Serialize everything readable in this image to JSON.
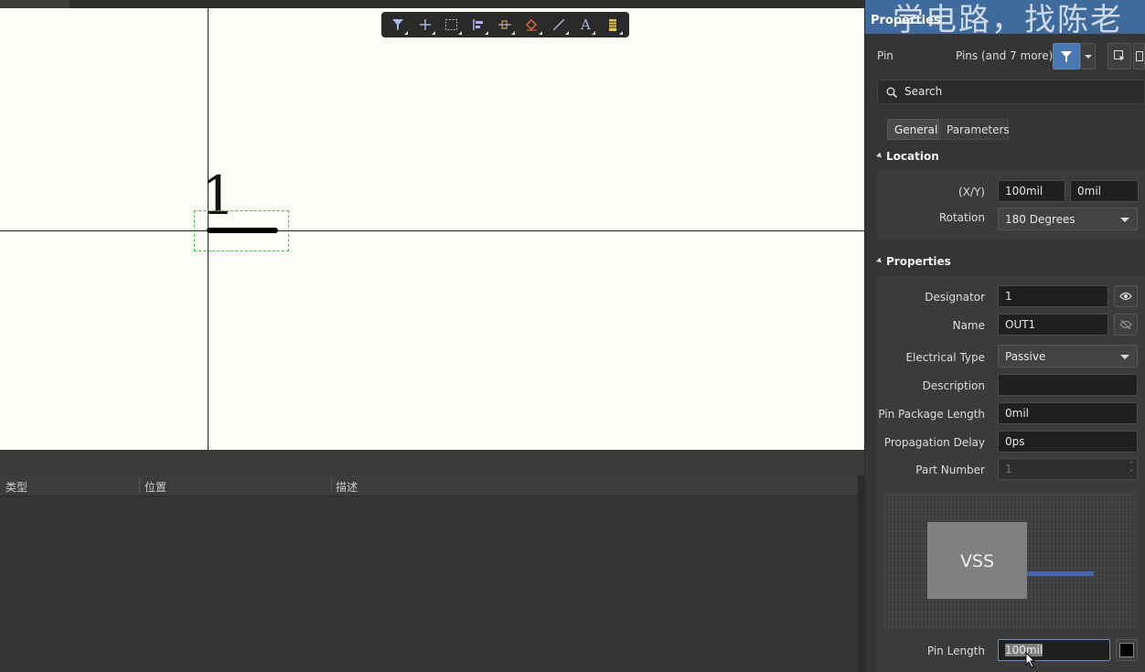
{
  "canvas": {
    "pin_designator": "1",
    "toolbar": [
      "filter-icon",
      "plus-icon",
      "select-rect-icon",
      "align-icon",
      "place-pin-icon",
      "eraser-icon",
      "line-icon",
      "text-icon",
      "component-icon"
    ]
  },
  "messages": {
    "columns": [
      "类型",
      "位置",
      "描述"
    ]
  },
  "properties": {
    "title": "Properties",
    "watermark": "学电路，找陈老",
    "object_type": "Pin",
    "selection": "Pins (and 7 more)",
    "search_placeholder": "Search",
    "tabs": [
      "General",
      "Parameters"
    ],
    "location": {
      "header": "Location",
      "xy_label": "(X/Y)",
      "x": "100mil",
      "y": "0mil",
      "rotation_label": "Rotation",
      "rotation": "180 Degrees"
    },
    "pin_props": {
      "header": "Properties",
      "designator_label": "Designator",
      "designator": "1",
      "name_label": "Name",
      "name": "OUT1",
      "electrical_type_label": "Electrical Type",
      "electrical_type": "Passive",
      "description_label": "Description",
      "description": "",
      "pkg_length_label": "Pin Package Length",
      "pkg_length": "0mil",
      "prop_delay_label": "Propagation Delay",
      "prop_delay": "0ps",
      "part_number_label": "Part Number",
      "part_number": "1",
      "preview_text": "VSS",
      "pin_length_label": "Pin Length",
      "pin_length": "100mil"
    },
    "colors": {
      "title_bar": "#3f6a9c",
      "pin_preview_line": "#4a64b4",
      "selection_box": "#3fbf3f"
    }
  }
}
